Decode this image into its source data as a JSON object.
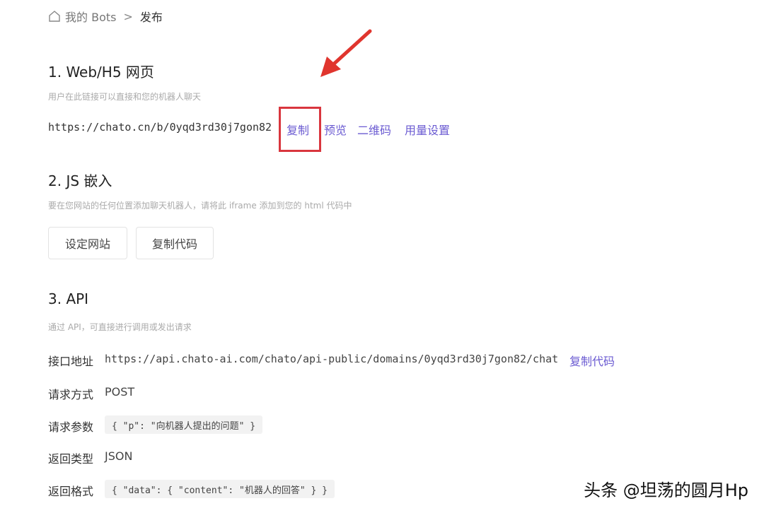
{
  "breadcrumb": {
    "home": "我的 Bots",
    "separator": ">",
    "current": "发布"
  },
  "section1": {
    "title": "1. Web/H5 网页",
    "desc": "用户在此链接可以直接和您的机器人聊天",
    "url": "https://chato.cn/b/0yqd3rd30j7gon82",
    "actions": {
      "copy": "复制",
      "preview": "预览",
      "qrcode": "二维码",
      "usage": "用量设置"
    }
  },
  "section2": {
    "title": "2. JS 嵌入",
    "desc": "要在您网站的任何位置添加聊天机器人，请将此 iframe 添加到您的 html 代码中",
    "buttons": {
      "set_site": "设定网站",
      "copy_code": "复制代码"
    }
  },
  "section3": {
    "title": "3. API",
    "desc": "通过 API，可直接进行调用或发出请求",
    "rows": {
      "endpoint_label": "接口地址",
      "endpoint_value": "https://api.chato-ai.com/chato/api-public/domains/0yqd3rd30j7gon82/chat",
      "endpoint_copy": "复制代码",
      "method_label": "请求方式",
      "method_value": "POST",
      "params_label": "请求参数",
      "params_value": "{ \"p\": \"向机器人提出的问题\" }",
      "return_type_label": "返回类型",
      "return_type_value": "JSON",
      "return_format_label": "返回格式",
      "return_format_value": "{ \"data\": { \"content\": \"机器人的回答\" } }"
    }
  },
  "annotation": {
    "highlight_color": "#d9363e",
    "arrow_color": "#e0352e"
  },
  "watermark": "头条 @坦荡的圆月Hp"
}
